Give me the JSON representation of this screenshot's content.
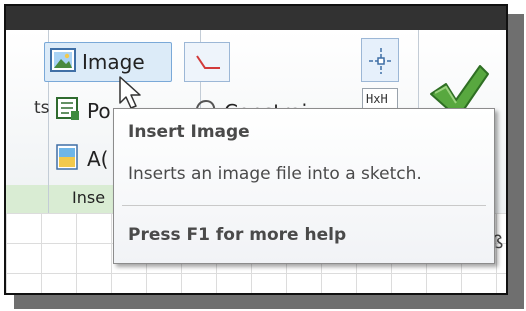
{
  "ribbon": {
    "left_partial_label": "ts",
    "buttons": {
      "image": {
        "label": "Image",
        "icon": "image-icon"
      },
      "points": {
        "label": "Po",
        "icon": "points-icon"
      },
      "acad": {
        "label": "A(",
        "icon": "acad-icon"
      },
      "line": {
        "icon": "line-icon"
      },
      "constraint": {
        "label": "Constrai",
        "icon": "constraint-icon"
      },
      "center_mark": {
        "icon": "center-mark-icon"
      },
      "dimension": {
        "icon": "dimension-icon",
        "text": "HxH"
      },
      "finish": {
        "icon": "checkmark-icon"
      }
    },
    "group_label_partial": "Inse"
  },
  "tooltip": {
    "title": "Insert Image",
    "description": "Inserts an image file into a sketch.",
    "help": "Press F1 for more help"
  },
  "colors": {
    "accent": "#7aa9d8",
    "green_check": "#57a83d",
    "footer_green": "#d9ecd3"
  }
}
